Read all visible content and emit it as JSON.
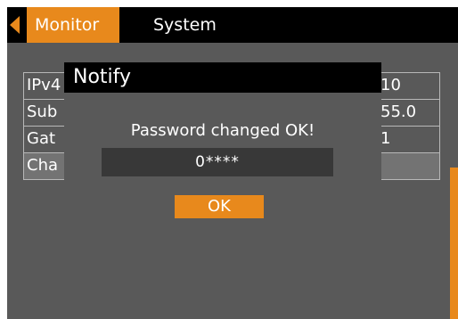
{
  "header": {
    "tabs": [
      {
        "label": "Monitor",
        "active": true
      },
      {
        "label": "System",
        "active": false
      }
    ]
  },
  "settings": {
    "rows": [
      {
        "label": "IPv4",
        "value": "10"
      },
      {
        "label": "Sub",
        "value": "55.0"
      },
      {
        "label": "Gat",
        "value": "1"
      },
      {
        "label": "Cha",
        "value": ""
      }
    ]
  },
  "dialog": {
    "title": "Notify",
    "message": "Password changed OK!",
    "password_value": "0****",
    "ok_label": "OK"
  },
  "colors": {
    "accent": "#e8891c",
    "background": "#595959",
    "bar": "#000000"
  },
  "icons": {
    "back": "chevron-left-icon"
  }
}
